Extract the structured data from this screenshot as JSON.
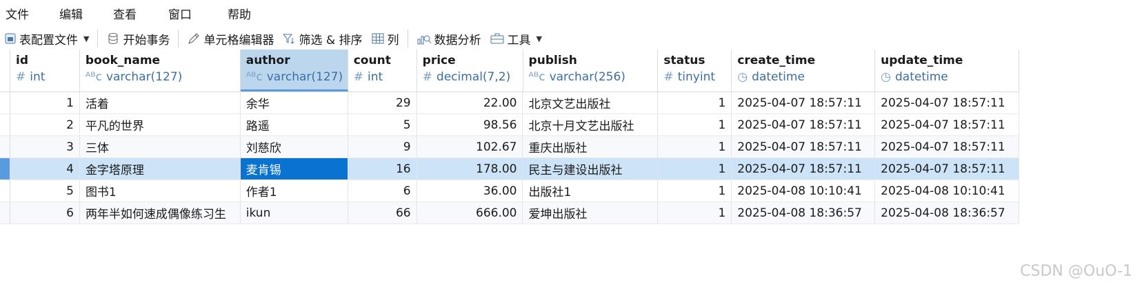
{
  "menu": [
    "文件",
    "编辑",
    "查看",
    "窗口",
    "帮助"
  ],
  "toolbar": {
    "table_config": "表配置文件",
    "begin_tx": "开始事务",
    "cell_editor": "单元格编辑器",
    "filter_sort": "筛选 & 排序",
    "columns": "列",
    "data_analysis": "数据分析",
    "tools": "工具"
  },
  "columns": [
    {
      "name": "id",
      "type": "int",
      "kind": "number"
    },
    {
      "name": "book_name",
      "type": "varchar(127)",
      "kind": "text"
    },
    {
      "name": "author",
      "type": "varchar(127)",
      "kind": "text"
    },
    {
      "name": "count",
      "type": "int",
      "kind": "number"
    },
    {
      "name": "price",
      "type": "decimal(7,2)",
      "kind": "number"
    },
    {
      "name": "publish",
      "type": "varchar(256)",
      "kind": "text"
    },
    {
      "name": "status",
      "type": "tinyint",
      "kind": "number"
    },
    {
      "name": "create_time",
      "type": "datetime",
      "kind": "time"
    },
    {
      "name": "update_time",
      "type": "datetime",
      "kind": "time"
    }
  ],
  "rows": [
    [
      "1",
      "活着",
      "余华",
      "29",
      "22.00",
      "北京文艺出版社",
      "1",
      "2025-04-07 18:57:11",
      "2025-04-07 18:57:11"
    ],
    [
      "2",
      "平凡的世界",
      "路遥",
      "5",
      "98.56",
      "北京十月文艺出版社",
      "1",
      "2025-04-07 18:57:11",
      "2025-04-07 18:57:11"
    ],
    [
      "3",
      "三体",
      "刘慈欣",
      "9",
      "102.67",
      "重庆出版社",
      "1",
      "2025-04-07 18:57:11",
      "2025-04-07 18:57:11"
    ],
    [
      "4",
      "金字塔原理",
      "麦肯锡",
      "16",
      "178.00",
      "民主与建设出版社",
      "1",
      "2025-04-07 18:57:11",
      "2025-04-07 18:57:11"
    ],
    [
      "5",
      "图书1",
      "作者1",
      "6",
      "36.00",
      "出版社1",
      "1",
      "2025-04-08 10:10:41",
      "2025-04-08 10:10:41"
    ],
    [
      "6",
      "两年半如何速成偶像练习生",
      "ikun",
      "66",
      "666.00",
      "爱坤出版社",
      "1",
      "2025-04-08 18:36:57",
      "2025-04-08 18:36:57"
    ]
  ],
  "watermark": "CSDN @OuO-1",
  "colors": {
    "accent": "#0a73d2",
    "selected_row": "#cde3f7",
    "header_selected": "#bcd6ee"
  }
}
